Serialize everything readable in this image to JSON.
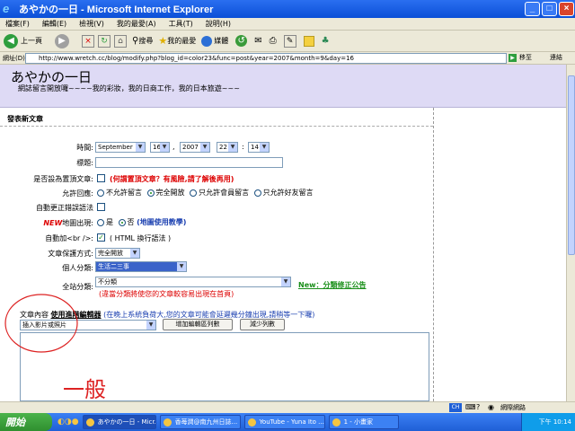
{
  "window": {
    "title": "あやかの一日 - Microsoft Internet Explorer"
  },
  "menu": [
    "檔案(F)",
    "編輯(E)",
    "檢視(V)",
    "我的最愛(A)",
    "工具(T)",
    "說明(H)"
  ],
  "toolbar": {
    "back": "上一頁",
    "search": "搜尋",
    "favorites": "我的最愛",
    "media": "媒體"
  },
  "address": {
    "label": "網址(D)",
    "url": "http://www.wretch.cc/blog/modify.php?blog_id=color23&func=post&year=2007&month=9&day=16",
    "go": "移至",
    "links": "連結"
  },
  "blog": {
    "title": "あやかの一日",
    "subtitle": "網誌留言開放囉~~~~我的彩妝，我的日商工作，我的日本旅遊~~~"
  },
  "form": {
    "heading": "發表新文章",
    "time_label": "時間:",
    "month": "September",
    "day": "16",
    "year": "2007",
    "hour": "22",
    "minute": "14",
    "subject_label": "標題:",
    "sticky_label": "是否設為置頂文章:",
    "sticky_warning": "(何謂置頂文章？有風險,請了解後再用)",
    "reply_label": "允許回應:",
    "reply_options": [
      "不允許留言",
      "完全開放",
      "只允許會員留言",
      "只允許好友留言"
    ],
    "autofix_label": "自動更正錯誤語法",
    "map_new": "NEW",
    "map_label": "地圖出現:",
    "map_yes": "是",
    "map_no": "否",
    "map_help": "(地圖使用教學)",
    "br_label": "自動加<br />:",
    "br_note": "( HTML 換行語法 )",
    "protect_label": "文章保護方式:",
    "protect_value": "完全開放",
    "personal_label": "個人分類:",
    "personal_value": "生活二三事",
    "site_label": "全站分類:",
    "site_value": "不分類",
    "site_warning": "(違當分類將使您的文章較容易出現在首頁)",
    "site_new": "New：分類修正公告",
    "editor_label": "文章內容",
    "editor_mode": "使用進階編輯器",
    "editor_note": "(在晚上系統負荷大,您的文章可能會延遲幾分鐘出現,請稍等一下囉)",
    "insert_value": "插入影片或照片",
    "add_rows_button": "增加編輯區列數",
    "reduce_rows_button": "減少列數",
    "handwriting": "一般"
  },
  "statusbar": {
    "zone": "網際網路",
    "ime": "CH"
  },
  "taskbar": {
    "start": "開始",
    "tasks": [
      "あやかの一日 - Micr...",
      "香苺潤@南九州日誌...",
      "YouTube - Yuna Ito ...",
      "1 - 小畫家"
    ],
    "clock": "下午 10:14"
  },
  "colors": {
    "header_bg": "#dedaf5",
    "xp_blue": "#0b4fd7",
    "warning": "#dd0000"
  }
}
